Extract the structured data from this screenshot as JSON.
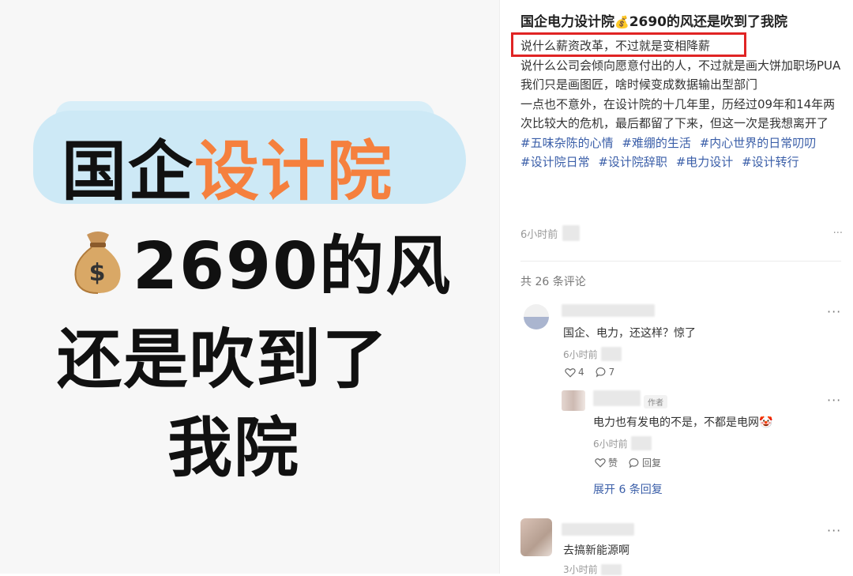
{
  "cover": {
    "line1_black": "国企",
    "line1_orange": "设计院",
    "line2": "2690的风",
    "line3": "还是吹到了",
    "line4": "我院",
    "bag_icon": "money-bag-icon"
  },
  "post": {
    "title_part1": "国企电力设计院",
    "title_part2": "2690的风还是吹到了我院",
    "highlight_color": "#e02424",
    "paragraphs": [
      "说什么薪资改革，不过就是变相降薪",
      "说什么公司会倾向愿意付出的人，不过就是画大饼加职场PUA",
      "我们只是画图匠，啥时候变成数据输出型部门",
      "一点也不意外，在设计院的十几年里，历经过09年和14年两次比较大的危机，最后都留了下来，但这一次是我想离开了"
    ],
    "tags": [
      "#五味杂陈的心情",
      "#难绷的生活",
      "#内心世界的日常叨叨",
      "#设计院日常",
      "#设计院辞职",
      "#电力设计",
      "#设计转行"
    ],
    "time": "6小时前",
    "more": "···"
  },
  "comments": {
    "count_label": "共 26 条评论",
    "items": [
      {
        "text": "国企、电力，还这样？惊了",
        "time": "6小时前",
        "likes": "4",
        "replies": "7",
        "more": "···"
      },
      {
        "author_tag": "作者",
        "text": "电力也有发电的不是，不都是电网",
        "time": "6小时前",
        "like_label": "赞",
        "reply_label": "回复",
        "more": "···"
      },
      {
        "expand_label": "展开 6 条回复"
      },
      {
        "text": "去搞新能源啊",
        "time": "3小时前",
        "more": "···"
      }
    ]
  },
  "colors": {
    "accent_orange": "#f5803e",
    "link_blue": "#3a5ea8",
    "blob_blue": "#cde9f6"
  }
}
